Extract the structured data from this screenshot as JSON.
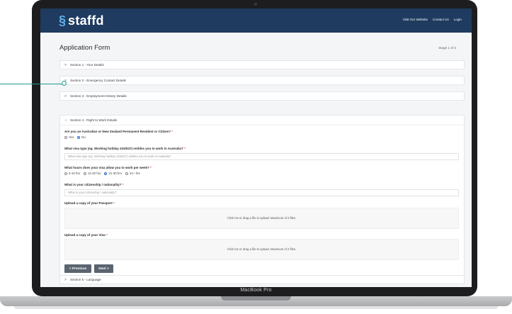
{
  "device": {
    "label": "MacBook Pro"
  },
  "nav": {
    "logo_text": "staffd",
    "logo_mark": "§",
    "links": [
      "Visit Our Website",
      "Contact Us",
      "Login"
    ]
  },
  "page": {
    "title": "Application Form",
    "stage": "Stage 1 of 3"
  },
  "sections": [
    {
      "label": "Section 1 - Your Details",
      "expanded": false
    },
    {
      "label": "Section 2 - Emergency Contact Details",
      "expanded": false
    },
    {
      "label": "Section 3 - Employment History Details",
      "expanded": false
    },
    {
      "label": "Section 4 - Right to Work Details",
      "expanded": true
    },
    {
      "label": "Section 5 - Language",
      "expanded": false
    }
  ],
  "form": {
    "q_citizen": "Are you an Australian or New Zealand Permanent Resident or Citizen?",
    "citizen_options": [
      "Yes",
      "No"
    ],
    "citizen_selected": "No",
    "q_visa_type": "What visa type (eg. Working holiday 415/547) entitles you to work in Australia?",
    "visa_type_placeholder": "What visa type (eg. Working holiday 415/547) entitles you to work in Australia?",
    "q_hours": "What hours does your visa allow you to work per week?",
    "hours_options": [
      "0-10 hrs",
      "11-20 hrs",
      "21-30 hrs",
      "31+ hrs"
    ],
    "hours_selected": "21-30 hrs",
    "q_citizenship": "What is your citizenship / nationality?",
    "citizenship_placeholder": "What is your citizenship / nationality?",
    "q_passport": "Upload a copy of your Passport",
    "q_visa_copy": "Upload a copy of your Visa",
    "upload_text": "Click me or drag a file to upload. Maximum of 2 files.",
    "required_mark": "*",
    "previous_label": "< Previous",
    "next_label": "Next >"
  },
  "colors": {
    "nav": "#1f3b60",
    "accent": "#5eb3ea",
    "callout": "#1c9a8e",
    "button": "#5b6470"
  }
}
